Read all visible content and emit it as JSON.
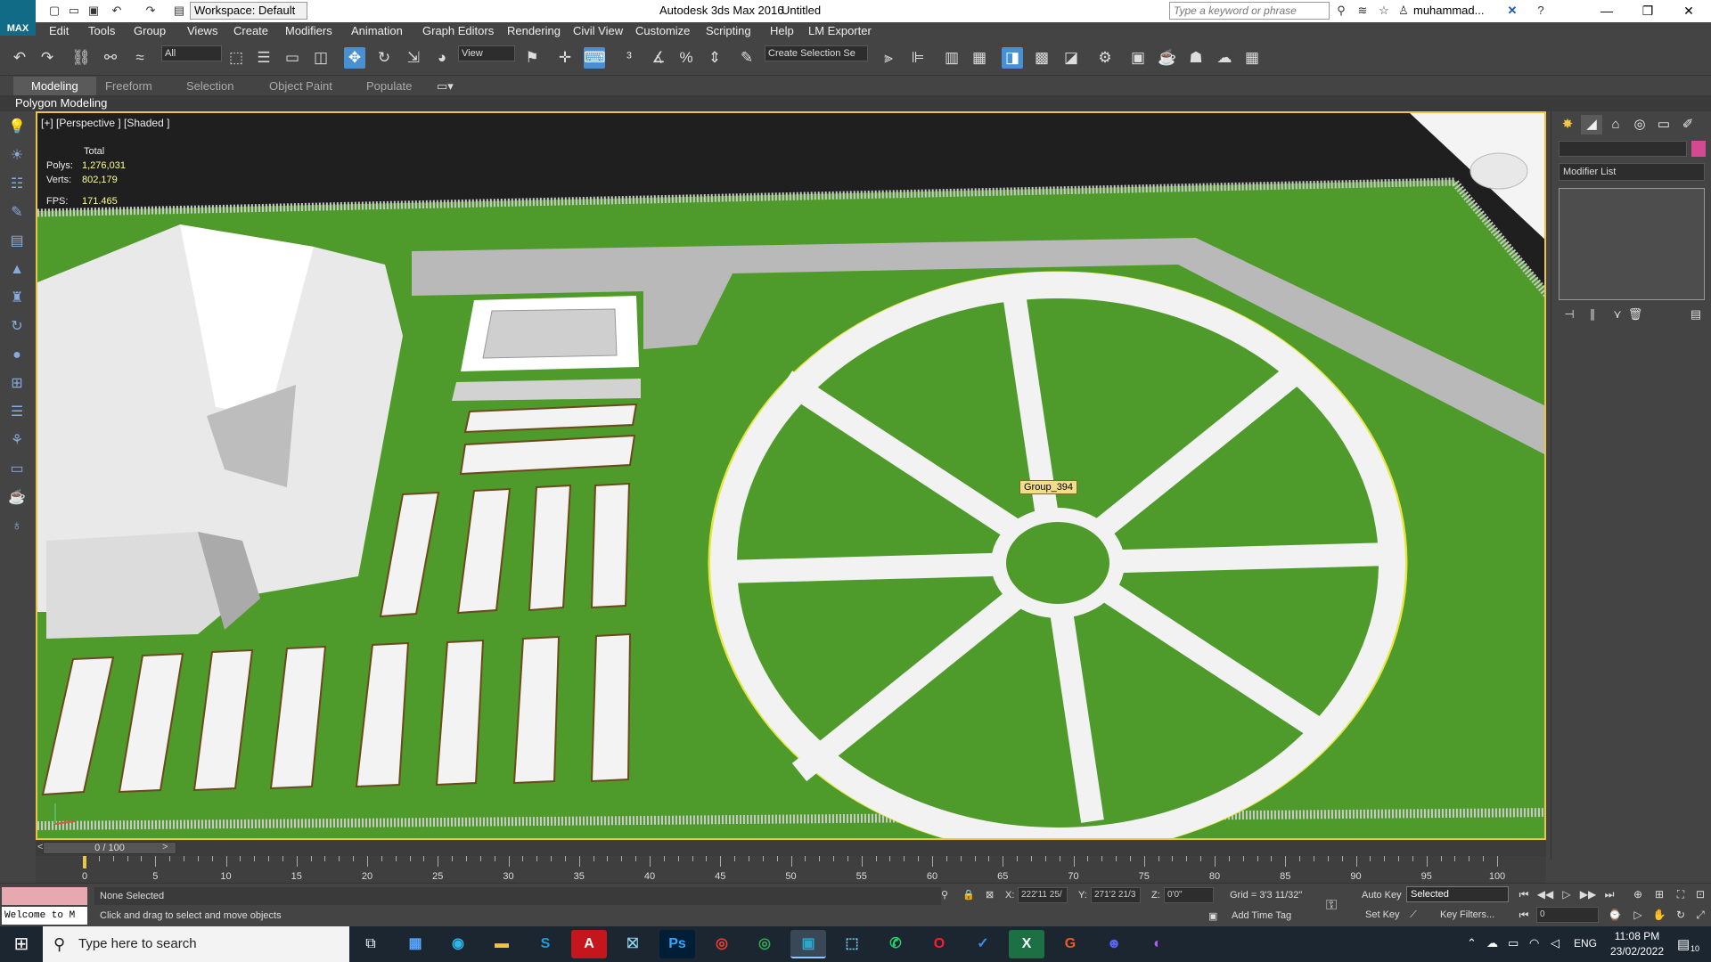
{
  "titlebar": {
    "app_title": "Autodesk 3ds Max 2016",
    "file_title": "Untitled",
    "workspace": "Workspace: Default",
    "search_placeholder": "Type a keyword or phrase",
    "username": "muhammad...",
    "logo_text": "MAX"
  },
  "menu": [
    "Edit",
    "Tools",
    "Group",
    "Views",
    "Create",
    "Modifiers",
    "Animation",
    "Graph Editors",
    "Rendering",
    "Civil View",
    "Customize",
    "Scripting",
    "Help",
    "LM Exporter"
  ],
  "toolbar": {
    "filter_value": "All",
    "ref_coord": "View",
    "selection_set_placeholder": "Create Selection Se"
  },
  "ribbon": {
    "tabs": [
      "Modeling",
      "Freeform",
      "Selection",
      "Object Paint",
      "Populate"
    ],
    "active_tab": "Modeling",
    "sub_label": "Polygon Modeling"
  },
  "viewport": {
    "label": "[+] [Perspective ] [Shaded ]",
    "stats_header": "Total",
    "polys_label": "Polys:",
    "polys_value": "1,276,031",
    "verts_label": "Verts:",
    "verts_value": "802,179",
    "fps_label": "FPS:",
    "fps_value": "171.465",
    "object_tooltip": "Group_394",
    "colors": {
      "grass": "#4e9a2a",
      "path": "#f2f2f2",
      "road": "#b9b9b9",
      "sky": "#1f1f1f",
      "highlight": "#e6e640"
    }
  },
  "command_panel": {
    "modifier_list": "Modifier List",
    "object_color": "#d34a92"
  },
  "timeline": {
    "slider_text": "0 / 100",
    "ticks": [
      0,
      5,
      10,
      15,
      20,
      25,
      30,
      35,
      40,
      45,
      50,
      55,
      60,
      65,
      70,
      75,
      80,
      85,
      90,
      95,
      100
    ]
  },
  "status": {
    "welcome": "Welcome to M",
    "selection": "None Selected",
    "prompt": "Click and drag to select and move objects",
    "x_label": "X:",
    "x_value": "222'11 25/",
    "y_label": "Y:",
    "y_value": "271'2 21/3",
    "z_label": "Z:",
    "z_value": "0'0\"",
    "grid": "Grid = 3'3 11/32\"",
    "add_time_tag": "Add Time Tag",
    "auto_key": "Auto Key",
    "set_key": "Set Key",
    "key_mode": "Selected",
    "key_filters": "Key Filters...",
    "frame": "0"
  },
  "taskbar": {
    "search_placeholder": "Type here to search",
    "language": "ENG",
    "time": "11:08 PM",
    "date": "23/02/2022",
    "notification_count": "10"
  }
}
